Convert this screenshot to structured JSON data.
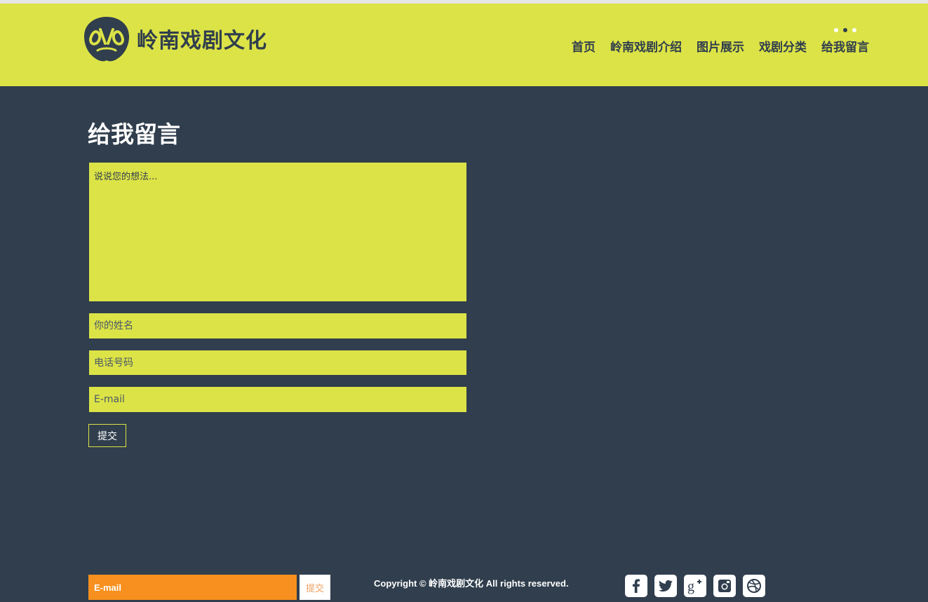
{
  "site": {
    "logo_text": "岭南戏剧文化",
    "logo_icon": "opera-mask-logo-icon"
  },
  "nav": {
    "items": [
      {
        "label": "首页"
      },
      {
        "label": "岭南戏剧介绍"
      },
      {
        "label": "图片展示"
      },
      {
        "label": "戏剧分类"
      },
      {
        "label": "给我留言",
        "active": true
      }
    ]
  },
  "main": {
    "title": "给我留言",
    "message_placeholder": "说说您的想法...",
    "name_placeholder": "你的姓名",
    "phone_placeholder": "电话号码",
    "email_placeholder": "E-mail",
    "submit_label": "提交"
  },
  "footer": {
    "email_placeholder": "E-mail",
    "submit_label": "提交",
    "copyright": "Copyright © 岭南戏剧文化 All rights reserved.",
    "social": [
      "facebook-icon",
      "twitter-icon",
      "google-plus-icon",
      "instagram-icon",
      "dribbble-icon"
    ]
  },
  "colors": {
    "accent": "#dce346",
    "background": "#303e4d",
    "footer_email": "#f7901e"
  }
}
